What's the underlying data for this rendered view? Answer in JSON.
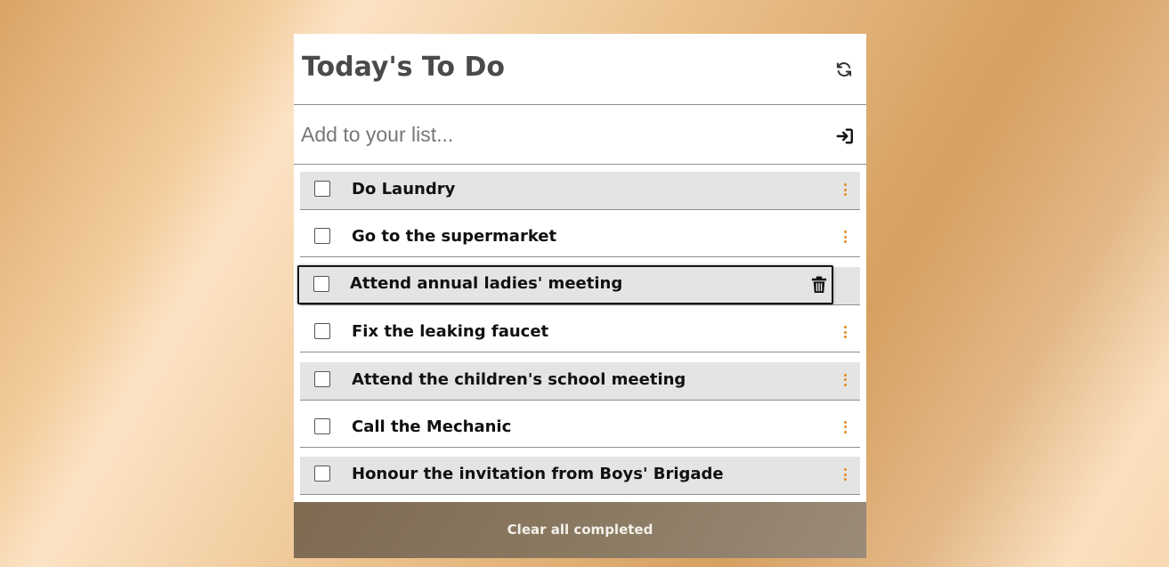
{
  "header": {
    "title": "Today's To Do",
    "refresh_icon": "refresh-icon"
  },
  "add": {
    "placeholder": "Add to your list...",
    "value": "",
    "submit_icon": "enter-icon"
  },
  "items": [
    {
      "label": "Do Laundry",
      "checked": false,
      "menu_icon": "more-vertical-icon"
    },
    {
      "label": "Go to the supermarket",
      "checked": false,
      "menu_icon": "more-vertical-icon"
    },
    {
      "label": "Attend annual ladies' meeting",
      "checked": false,
      "state": "dragging",
      "action_icon": "trash-icon"
    },
    {
      "label": "Fix the leaking faucet",
      "checked": false,
      "menu_icon": "more-vertical-icon"
    },
    {
      "label": "Attend the children's school meeting",
      "checked": false,
      "menu_icon": "more-vertical-icon"
    },
    {
      "label": "Call the Mechanic",
      "checked": false,
      "menu_icon": "more-vertical-icon"
    },
    {
      "label": "Honour the invitation from Boys' Brigade",
      "checked": false,
      "menu_icon": "more-vertical-icon"
    }
  ],
  "footer": {
    "clear_label": "Clear all completed"
  },
  "colors": {
    "accent_dots": "#e58a1f",
    "footer_bg": "#8a7961",
    "row_shade": "#e4e4e4"
  }
}
